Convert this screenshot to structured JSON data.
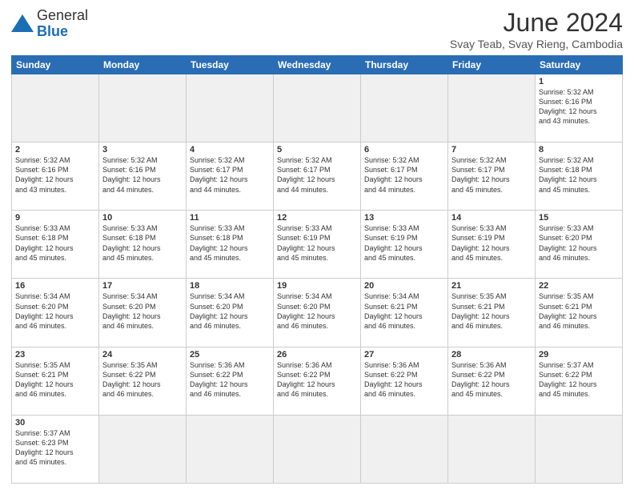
{
  "header": {
    "logo_general": "General",
    "logo_blue": "Blue",
    "title": "June 2024",
    "subtitle": "Svay Teab, Svay Rieng, Cambodia"
  },
  "days_of_week": [
    "Sunday",
    "Monday",
    "Tuesday",
    "Wednesday",
    "Thursday",
    "Friday",
    "Saturday"
  ],
  "weeks": [
    [
      {
        "num": "",
        "info": "",
        "empty": true
      },
      {
        "num": "",
        "info": "",
        "empty": true
      },
      {
        "num": "",
        "info": "",
        "empty": true
      },
      {
        "num": "",
        "info": "",
        "empty": true
      },
      {
        "num": "",
        "info": "",
        "empty": true
      },
      {
        "num": "",
        "info": "",
        "empty": true
      },
      {
        "num": "1",
        "info": "Sunrise: 5:32 AM\nSunset: 6:16 PM\nDaylight: 12 hours\nand 43 minutes.",
        "empty": false
      }
    ],
    [
      {
        "num": "2",
        "info": "Sunrise: 5:32 AM\nSunset: 6:16 PM\nDaylight: 12 hours\nand 43 minutes.",
        "empty": false
      },
      {
        "num": "3",
        "info": "Sunrise: 5:32 AM\nSunset: 6:16 PM\nDaylight: 12 hours\nand 44 minutes.",
        "empty": false
      },
      {
        "num": "4",
        "info": "Sunrise: 5:32 AM\nSunset: 6:17 PM\nDaylight: 12 hours\nand 44 minutes.",
        "empty": false
      },
      {
        "num": "5",
        "info": "Sunrise: 5:32 AM\nSunset: 6:17 PM\nDaylight: 12 hours\nand 44 minutes.",
        "empty": false
      },
      {
        "num": "6",
        "info": "Sunrise: 5:32 AM\nSunset: 6:17 PM\nDaylight: 12 hours\nand 44 minutes.",
        "empty": false
      },
      {
        "num": "7",
        "info": "Sunrise: 5:32 AM\nSunset: 6:17 PM\nDaylight: 12 hours\nand 45 minutes.",
        "empty": false
      },
      {
        "num": "8",
        "info": "Sunrise: 5:32 AM\nSunset: 6:18 PM\nDaylight: 12 hours\nand 45 minutes.",
        "empty": false
      }
    ],
    [
      {
        "num": "9",
        "info": "Sunrise: 5:33 AM\nSunset: 6:18 PM\nDaylight: 12 hours\nand 45 minutes.",
        "empty": false
      },
      {
        "num": "10",
        "info": "Sunrise: 5:33 AM\nSunset: 6:18 PM\nDaylight: 12 hours\nand 45 minutes.",
        "empty": false
      },
      {
        "num": "11",
        "info": "Sunrise: 5:33 AM\nSunset: 6:18 PM\nDaylight: 12 hours\nand 45 minutes.",
        "empty": false
      },
      {
        "num": "12",
        "info": "Sunrise: 5:33 AM\nSunset: 6:19 PM\nDaylight: 12 hours\nand 45 minutes.",
        "empty": false
      },
      {
        "num": "13",
        "info": "Sunrise: 5:33 AM\nSunset: 6:19 PM\nDaylight: 12 hours\nand 45 minutes.",
        "empty": false
      },
      {
        "num": "14",
        "info": "Sunrise: 5:33 AM\nSunset: 6:19 PM\nDaylight: 12 hours\nand 45 minutes.",
        "empty": false
      },
      {
        "num": "15",
        "info": "Sunrise: 5:33 AM\nSunset: 6:20 PM\nDaylight: 12 hours\nand 46 minutes.",
        "empty": false
      }
    ],
    [
      {
        "num": "16",
        "info": "Sunrise: 5:34 AM\nSunset: 6:20 PM\nDaylight: 12 hours\nand 46 minutes.",
        "empty": false
      },
      {
        "num": "17",
        "info": "Sunrise: 5:34 AM\nSunset: 6:20 PM\nDaylight: 12 hours\nand 46 minutes.",
        "empty": false
      },
      {
        "num": "18",
        "info": "Sunrise: 5:34 AM\nSunset: 6:20 PM\nDaylight: 12 hours\nand 46 minutes.",
        "empty": false
      },
      {
        "num": "19",
        "info": "Sunrise: 5:34 AM\nSunset: 6:20 PM\nDaylight: 12 hours\nand 46 minutes.",
        "empty": false
      },
      {
        "num": "20",
        "info": "Sunrise: 5:34 AM\nSunset: 6:21 PM\nDaylight: 12 hours\nand 46 minutes.",
        "empty": false
      },
      {
        "num": "21",
        "info": "Sunrise: 5:35 AM\nSunset: 6:21 PM\nDaylight: 12 hours\nand 46 minutes.",
        "empty": false
      },
      {
        "num": "22",
        "info": "Sunrise: 5:35 AM\nSunset: 6:21 PM\nDaylight: 12 hours\nand 46 minutes.",
        "empty": false
      }
    ],
    [
      {
        "num": "23",
        "info": "Sunrise: 5:35 AM\nSunset: 6:21 PM\nDaylight: 12 hours\nand 46 minutes.",
        "empty": false
      },
      {
        "num": "24",
        "info": "Sunrise: 5:35 AM\nSunset: 6:22 PM\nDaylight: 12 hours\nand 46 minutes.",
        "empty": false
      },
      {
        "num": "25",
        "info": "Sunrise: 5:36 AM\nSunset: 6:22 PM\nDaylight: 12 hours\nand 46 minutes.",
        "empty": false
      },
      {
        "num": "26",
        "info": "Sunrise: 5:36 AM\nSunset: 6:22 PM\nDaylight: 12 hours\nand 46 minutes.",
        "empty": false
      },
      {
        "num": "27",
        "info": "Sunrise: 5:36 AM\nSunset: 6:22 PM\nDaylight: 12 hours\nand 46 minutes.",
        "empty": false
      },
      {
        "num": "28",
        "info": "Sunrise: 5:36 AM\nSunset: 6:22 PM\nDaylight: 12 hours\nand 45 minutes.",
        "empty": false
      },
      {
        "num": "29",
        "info": "Sunrise: 5:37 AM\nSunset: 6:22 PM\nDaylight: 12 hours\nand 45 minutes.",
        "empty": false
      }
    ],
    [
      {
        "num": "30",
        "info": "Sunrise: 5:37 AM\nSunset: 6:23 PM\nDaylight: 12 hours\nand 45 minutes.",
        "empty": false
      },
      {
        "num": "",
        "info": "",
        "empty": true
      },
      {
        "num": "",
        "info": "",
        "empty": true
      },
      {
        "num": "",
        "info": "",
        "empty": true
      },
      {
        "num": "",
        "info": "",
        "empty": true
      },
      {
        "num": "",
        "info": "",
        "empty": true
      },
      {
        "num": "",
        "info": "",
        "empty": true
      }
    ]
  ]
}
